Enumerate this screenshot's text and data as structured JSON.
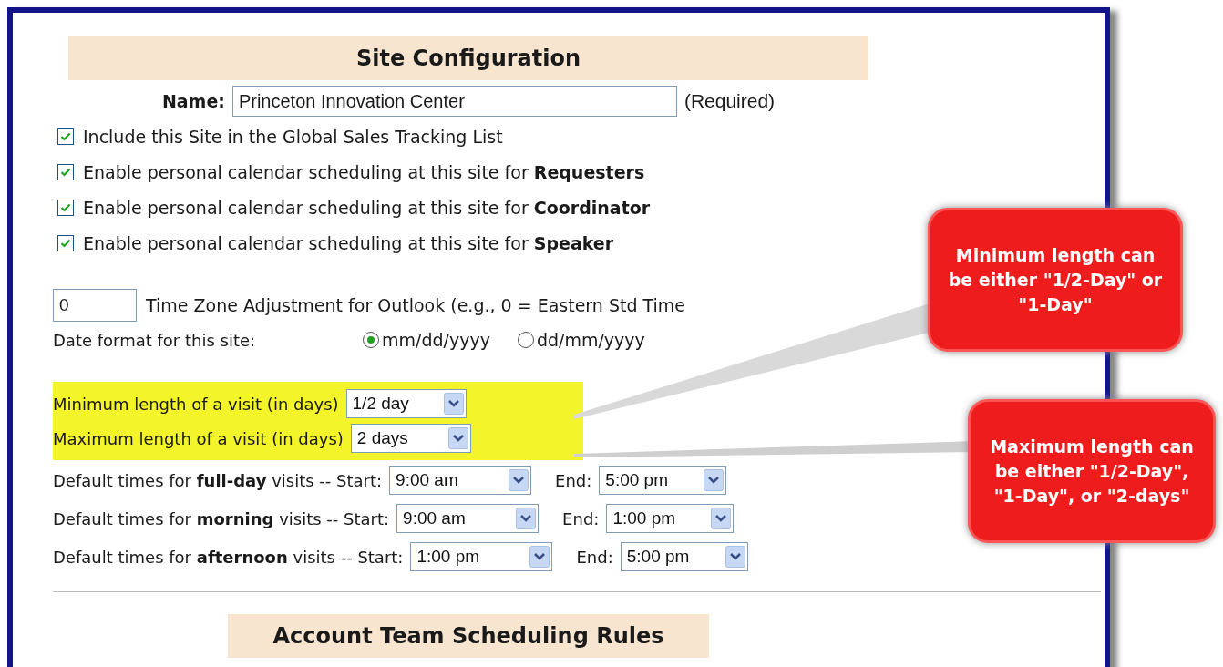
{
  "title": "Site Configuration",
  "name_field": {
    "label": "Name:",
    "value": "Princeton Innovation Center",
    "note": "(Required)"
  },
  "options": [
    {
      "label": "Include this Site in the Global Sales Tracking List",
      "checked": true
    },
    {
      "label": "Enable personal calendar scheduling at this site for **Requesters**",
      "checked": true
    },
    {
      "label": "Enable personal calendar scheduling at this site for **Coordinator**",
      "checked": true
    },
    {
      "label": "Enable personal calendar scheduling at this site for **Speaker**",
      "checked": true
    }
  ],
  "timezone": {
    "value": "0",
    "label": "Time Zone Adjustment for Outlook (e.g., 0 = Eastern Std Time"
  },
  "date_format": {
    "label": "Date format for this site:",
    "options": [
      {
        "label": "mm/dd/yyyy",
        "selected": true
      },
      {
        "label": "dd/mm/yyyy",
        "selected": false
      }
    ]
  },
  "visit_length": {
    "highlighted": true,
    "rows": [
      {
        "label": "Minimum length of a visit (in days)",
        "value": "1/2 day"
      },
      {
        "label": "Maximum length of a visit (in days)",
        "value": "2 days"
      }
    ]
  },
  "default_times": [
    {
      "label": "Default times for **full-day** visits -- Start:",
      "start": "9:00 am",
      "end_label": "End:",
      "end": "5:00 pm"
    },
    {
      "label": "Default times for **morning** visits -- Start:",
      "start": "9:00 am",
      "end_label": "End:",
      "end": "1:00 pm"
    },
    {
      "label": "Default times for **afternoon** visits -- Start:",
      "start": "1:00 pm",
      "end_label": "End:",
      "end": "5:00 pm"
    }
  ],
  "next_section": "Account Team Scheduling Rules",
  "callouts": [
    {
      "text": "Minimum length can be either \"1/2-Day\" or \"1-Day\""
    },
    {
      "text": "Maximum length can be either \"1/2-Day\", \"1-Day\", or \"2-days\""
    }
  ]
}
